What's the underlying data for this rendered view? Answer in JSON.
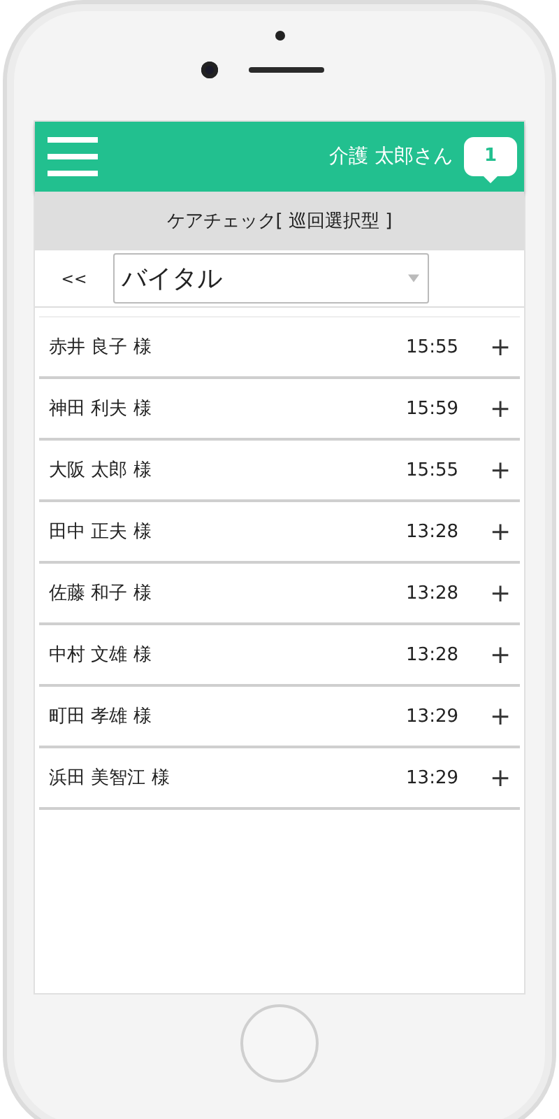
{
  "header": {
    "user_name": "介護 太郎さん",
    "notification_count": "1"
  },
  "title": "ケアチェック[ 巡回選択型 ]",
  "toolbar": {
    "back": "<<",
    "select_value": "バイタル"
  },
  "residents": [
    {
      "name": "赤井 良子 様",
      "time": "15:55",
      "action": "+"
    },
    {
      "name": "神田 利夫 様",
      "time": "15:59",
      "action": "+"
    },
    {
      "name": "大阪 太郎 様",
      "time": "15:55",
      "action": "+"
    },
    {
      "name": "田中 正夫 様",
      "time": "13:28",
      "action": "+"
    },
    {
      "name": "佐藤 和子 様",
      "time": "13:28",
      "action": "+"
    },
    {
      "name": "中村 文雄 様",
      "time": "13:28",
      "action": "+"
    },
    {
      "name": "町田 孝雄 様",
      "time": "13:29",
      "action": "+"
    },
    {
      "name": "浜田 美智江 様",
      "time": "13:29",
      "action": "+"
    }
  ]
}
